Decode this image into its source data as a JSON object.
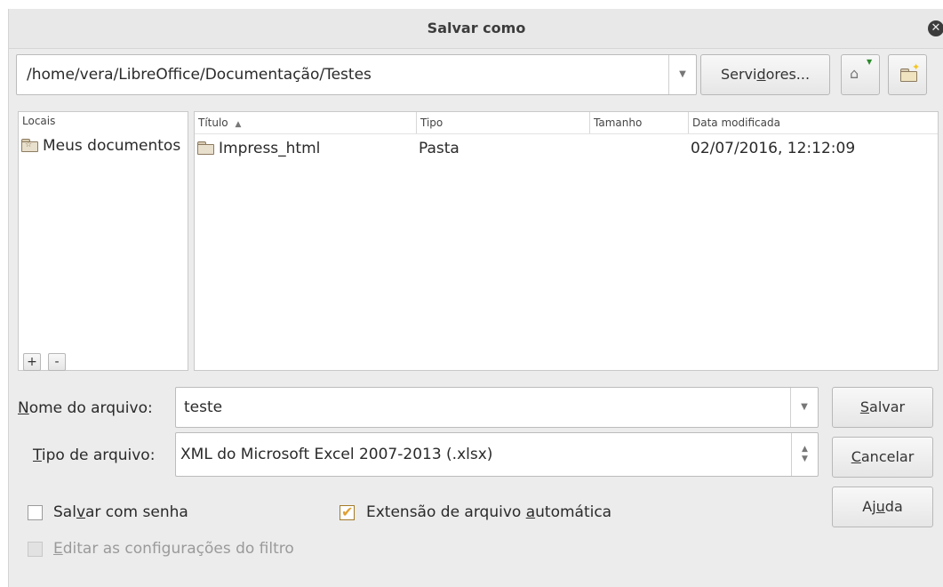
{
  "dialog": {
    "title": "Salvar como"
  },
  "path_bar": {
    "path": "/home/vera/LibreOffice/Documentação/Testes",
    "servers_label_pre": "Servi",
    "servers_label_u": "d",
    "servers_label_post": "ores..."
  },
  "places": {
    "header": "Locais",
    "items": [
      {
        "label": "Meus documentos",
        "icon": "favorite-folder-icon"
      }
    ],
    "add_label": "+",
    "remove_label": "-"
  },
  "files": {
    "columns": [
      {
        "label": "Título",
        "sort": "ascending"
      },
      {
        "label": "Tipo"
      },
      {
        "label": "Tamanho"
      },
      {
        "label": "Data modificada"
      }
    ],
    "rows": [
      {
        "name": "Impress_html",
        "type": "Pasta",
        "size": "",
        "modified": "02/07/2016, 12:12:09",
        "icon": "folder-icon"
      }
    ]
  },
  "filename": {
    "label_u": "N",
    "label_rest": "ome do arquivo:",
    "value": "teste"
  },
  "filetype": {
    "label_u": "T",
    "label_rest": "ipo de arquivo:",
    "value": "XML do Microsoft Excel 2007-2013 (.xlsx)"
  },
  "buttons": {
    "save_u": "S",
    "save_rest": "alvar",
    "cancel_u": "C",
    "cancel_rest": "ancelar",
    "help_pre": "Aj",
    "help_u": "u",
    "help_post": "da"
  },
  "options": {
    "password_pre": "Sal",
    "password_u": "v",
    "password_post": "ar com senha",
    "password_checked": false,
    "auto_ext_pre": "Extensão de arquivo ",
    "auto_ext_u": "a",
    "auto_ext_post": "utomática",
    "auto_ext_checked": true,
    "filter_u": "E",
    "filter_rest": "ditar as configurações do filtro",
    "filter_checked": false,
    "filter_enabled": false
  },
  "colors": {
    "check_accent": "#e0a030",
    "disabled_text": "#9a9a9a"
  }
}
